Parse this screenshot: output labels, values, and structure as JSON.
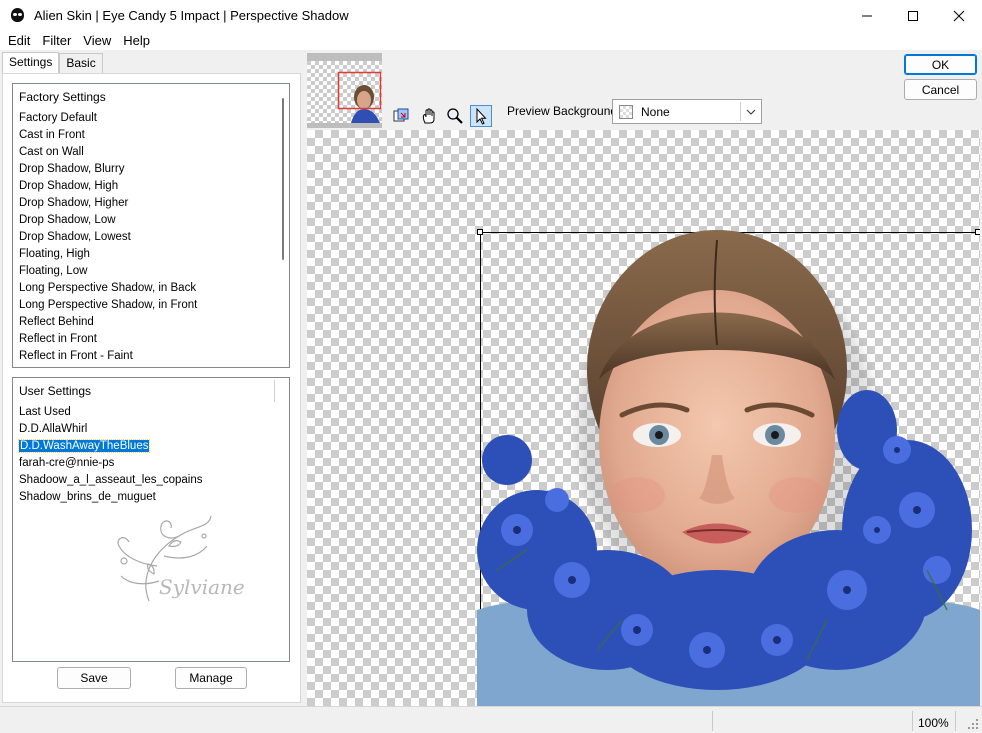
{
  "window": {
    "title": "Alien Skin | Eye Candy 5 Impact | Perspective Shadow"
  },
  "menu": [
    "Edit",
    "Filter",
    "View",
    "Help"
  ],
  "tabs": {
    "settings": "Settings",
    "basic": "Basic"
  },
  "factory": {
    "header": "Factory Settings",
    "items": [
      "Factory Default",
      "Cast in Front",
      "Cast on Wall",
      "Drop Shadow, Blurry",
      "Drop Shadow, High",
      "Drop Shadow, Higher",
      "Drop Shadow, Low",
      "Drop Shadow, Lowest",
      "Floating, High",
      "Floating, Low",
      "Long Perspective Shadow, in Back",
      "Long Perspective Shadow, in Front",
      "Reflect Behind",
      "Reflect in Front",
      "Reflect in Front - Faint"
    ]
  },
  "user": {
    "header": "User Settings",
    "items": [
      "Last Used",
      "D.D.AllaWhirl",
      "D.D.WashAwayTheBlues",
      "farah-cre@nnie-ps",
      "Shadoow_a_l_asseaut_les_copains",
      "Shadow_brins_de_muguet"
    ],
    "selected_index": 2,
    "watermark": "Sylviane"
  },
  "buttons": {
    "save": "Save",
    "manage": "Manage",
    "ok": "OK",
    "cancel": "Cancel"
  },
  "preview_background": {
    "label": "Preview Background:",
    "value": "None"
  },
  "tools": [
    "navigate-icon",
    "hand-icon",
    "zoom-icon",
    "pointer-icon"
  ],
  "status": {
    "zoom": "100%"
  },
  "colors": {
    "selection": "#0078d7",
    "thumb_frame": "#e53935",
    "flowers": "#2d4fb8"
  }
}
